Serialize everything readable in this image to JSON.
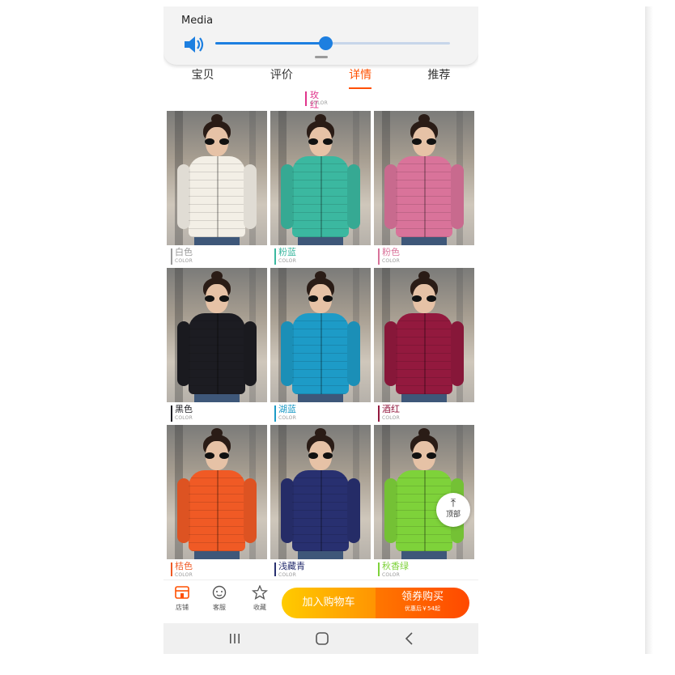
{
  "media": {
    "label": "Media",
    "volume_level": 0.47
  },
  "tabs": [
    {
      "label": "宝贝"
    },
    {
      "label": "评价"
    },
    {
      "label": "详情",
      "active": true
    },
    {
      "label": "推荐"
    }
  ],
  "top_label": {
    "name": "玫红",
    "sub": "COLOR",
    "color": "#e0348b"
  },
  "products": [
    {
      "name": "白色",
      "sub": "COLOR",
      "jacket": "#f3efe6",
      "bar": "#9a9a9a"
    },
    {
      "name": "粉蓝",
      "sub": "COLOR",
      "jacket": "#3bb8a0",
      "bar": "#3bb8a0"
    },
    {
      "name": "粉色",
      "sub": "COLOR",
      "jacket": "#d9739a",
      "bar": "#d9739a"
    },
    {
      "name": "黑色",
      "sub": "COLOR",
      "jacket": "#1c1c22",
      "bar": "#1c1c22"
    },
    {
      "name": "湖蓝",
      "sub": "COLOR",
      "jacket": "#1d9bc7",
      "bar": "#1d9bc7"
    },
    {
      "name": "酒红",
      "sub": "COLOR",
      "jacket": "#93193e",
      "bar": "#93193e"
    },
    {
      "name": "桔色",
      "sub": "COLOR",
      "jacket": "#f05a25",
      "bar": "#f05a25"
    },
    {
      "name": "浅藏青",
      "sub": "COLOR",
      "jacket": "#283070",
      "bar": "#283070"
    },
    {
      "name": "秋香绿",
      "sub": "COLOR",
      "jacket": "#7ed23a",
      "bar": "#7ed23a"
    }
  ],
  "float_top": {
    "label": "顶部"
  },
  "bottom_bar": {
    "store_label": "店铺",
    "service_label": "客服",
    "favorite_label": "收藏",
    "cart_label": "加入购物车",
    "buy_label": "领券购买",
    "buy_sub": "优惠后￥54起"
  },
  "colors": {
    "accent": "#ff5000",
    "slider": "#1d7fe0"
  }
}
